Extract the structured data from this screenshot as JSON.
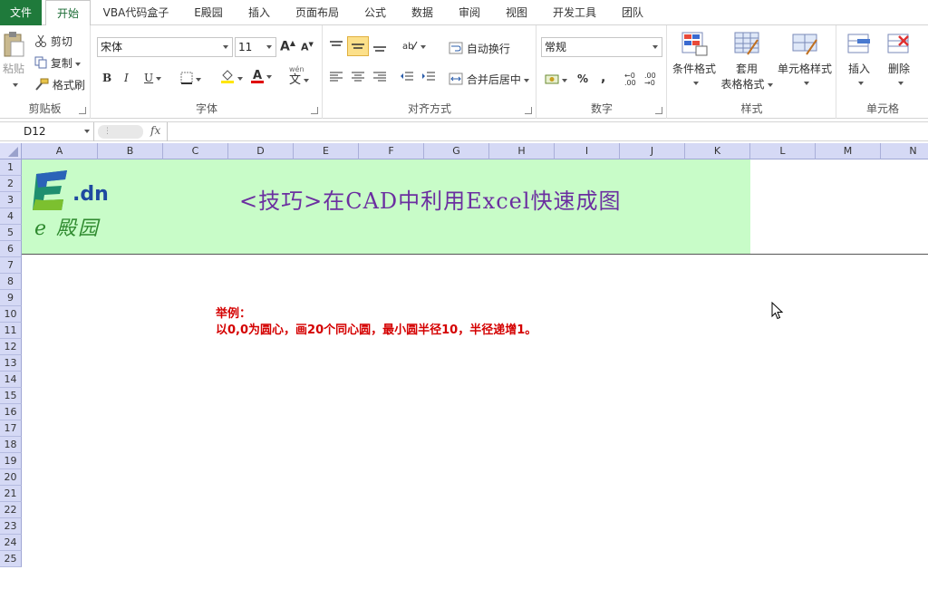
{
  "tabs": [
    {
      "label": "文件",
      "kind": "file"
    },
    {
      "label": "开始",
      "kind": "active"
    },
    {
      "label": "VBA代码盒子",
      "kind": "normal"
    },
    {
      "label": "E殿园",
      "kind": "normal"
    },
    {
      "label": "插入",
      "kind": "normal"
    },
    {
      "label": "页面布局",
      "kind": "normal"
    },
    {
      "label": "公式",
      "kind": "normal"
    },
    {
      "label": "数据",
      "kind": "normal"
    },
    {
      "label": "审阅",
      "kind": "normal"
    },
    {
      "label": "视图",
      "kind": "normal"
    },
    {
      "label": "开发工具",
      "kind": "normal"
    },
    {
      "label": "团队",
      "kind": "normal"
    }
  ],
  "clipboard": {
    "label": "剪贴板",
    "paste": "粘贴",
    "cut": "剪切",
    "copy": "复制",
    "format_painter": "格式刷"
  },
  "font": {
    "label": "字体",
    "name": "宋体",
    "size": "11",
    "bold": "B",
    "italic": "I",
    "underline": "U",
    "grow": "A",
    "shrink": "A",
    "font_color_letter": "A",
    "phonetic": "文"
  },
  "alignment": {
    "label": "对齐方式",
    "wrap_text": "自动换行",
    "merge_center": "合并后居中"
  },
  "number": {
    "label": "数字",
    "format": "常规",
    "percent": "%",
    "comma": ","
  },
  "styles": {
    "label": "样式",
    "conditional": "条件格式",
    "table_format_1": "套用",
    "table_format_2": "表格格式",
    "cell_styles": "单元格样式"
  },
  "cells": {
    "label": "单元格",
    "insert": "插入",
    "delete": "删除"
  },
  "formula_bar": {
    "name_box": "D12",
    "fx": "fx",
    "formula": ""
  },
  "columns": [
    "A",
    "B",
    "C",
    "D",
    "E",
    "F",
    "G",
    "H",
    "I",
    "J",
    "K",
    "L",
    "M",
    "N"
  ],
  "rows": [
    "1",
    "2",
    "3",
    "4",
    "5",
    "6",
    "7",
    "8",
    "9",
    "10",
    "11",
    "12",
    "13",
    "14",
    "15",
    "16",
    "17",
    "18",
    "19",
    "20",
    "21",
    "22",
    "23",
    "24",
    "25"
  ],
  "banner": {
    "title": "<技巧>在CAD中利用Excel快速成图",
    "logo_dn": ".dn",
    "logo_sub": "e 殿园",
    "background": "#c8fcc8",
    "title_color": "#6b2fa0"
  },
  "example": {
    "title": "举例：",
    "text": "以0,0为圆心，画20个同心圆，最小圆半径10，半径递增1。",
    "color": "#d40000"
  },
  "colors": {
    "accent": "#1f7a3b",
    "header_bg": "#d5d9f5"
  }
}
